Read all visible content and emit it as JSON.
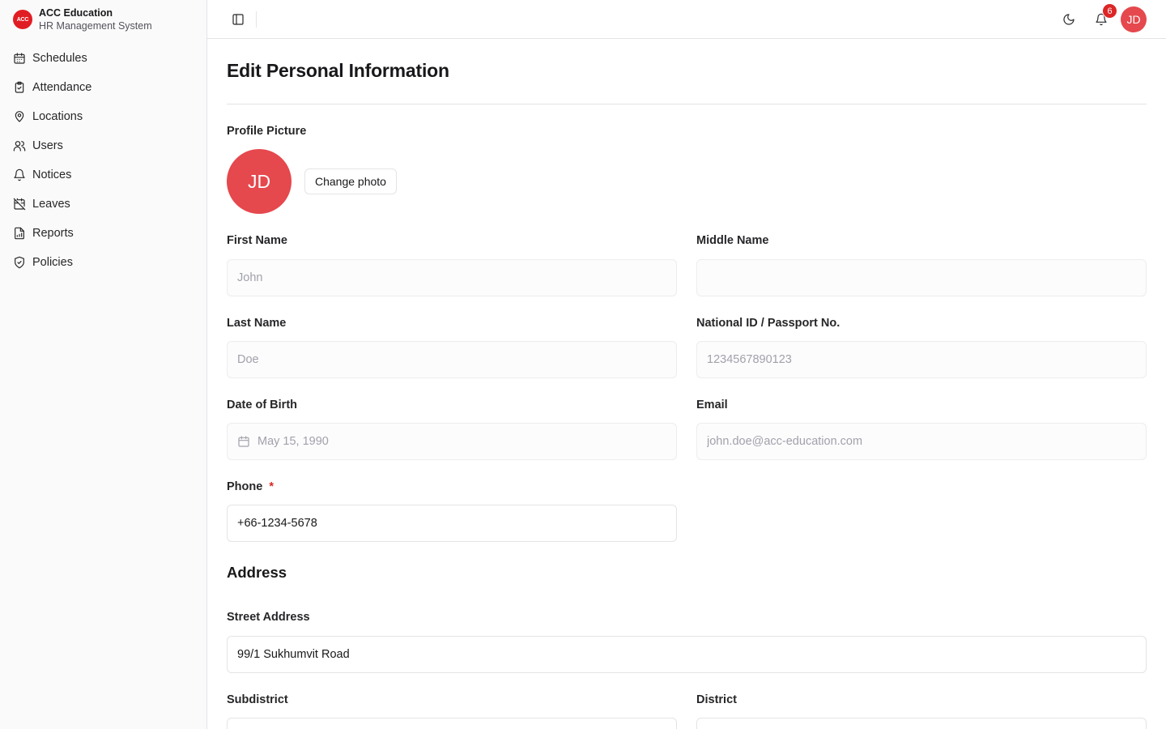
{
  "brand": {
    "logo_text": "ACC",
    "name": "ACC Education",
    "subtitle": "HR Management System"
  },
  "sidebar": {
    "items": [
      {
        "label": "Schedules",
        "icon": "calendar-icon"
      },
      {
        "label": "Attendance",
        "icon": "clipboard-check-icon"
      },
      {
        "label": "Locations",
        "icon": "map-pin-icon"
      },
      {
        "label": "Users",
        "icon": "users-icon"
      },
      {
        "label": "Notices",
        "icon": "bell-icon"
      },
      {
        "label": "Leaves",
        "icon": "calendar-off-icon"
      },
      {
        "label": "Reports",
        "icon": "file-chart-icon"
      },
      {
        "label": "Policies",
        "icon": "shield-check-icon"
      }
    ]
  },
  "header": {
    "notification_count": "6",
    "avatar_initials": "JD"
  },
  "page": {
    "title": "Edit Personal Information",
    "profile": {
      "label": "Profile Picture",
      "initials": "JD",
      "change_label": "Change photo"
    },
    "fields": {
      "first_name": {
        "label": "First Name",
        "value": "John"
      },
      "middle_name": {
        "label": "Middle Name",
        "value": ""
      },
      "last_name": {
        "label": "Last Name",
        "value": "Doe"
      },
      "national_id": {
        "label": "National ID / Passport No.",
        "value": "1234567890123"
      },
      "dob": {
        "label": "Date of Birth",
        "value": "May 15, 1990"
      },
      "email": {
        "label": "Email",
        "value": "john.doe@acc-education.com"
      },
      "phone": {
        "label": "Phone",
        "required_mark": "*",
        "value": "+66-1234-5678"
      }
    },
    "address": {
      "title": "Address",
      "street": {
        "label": "Street Address",
        "value": "99/1 Sukhumvit Road"
      },
      "subdistrict": {
        "label": "Subdistrict",
        "value": ""
      },
      "district": {
        "label": "District",
        "value": ""
      }
    }
  },
  "colors": {
    "accent": "#e11d24",
    "avatar": "#e5484d",
    "required": "#dc2626",
    "border": "#e4e4e7"
  }
}
